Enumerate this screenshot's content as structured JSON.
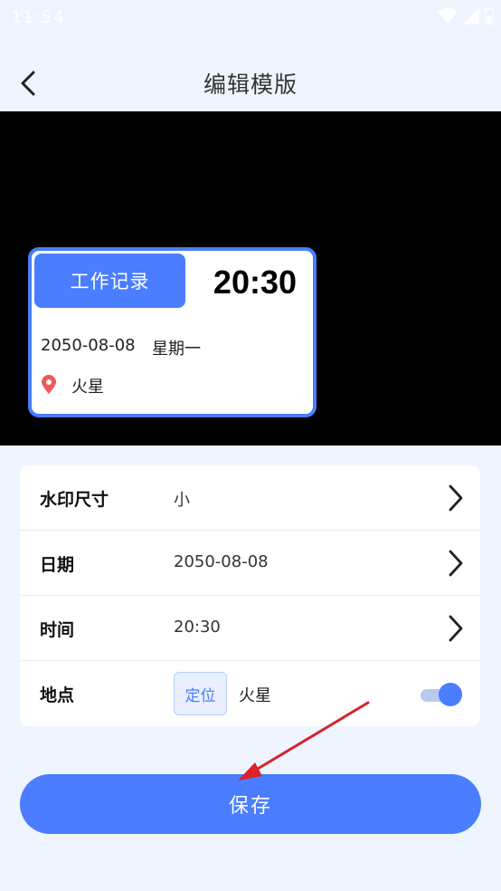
{
  "status_bar": {
    "time": "11:54",
    "icons": [
      "wifi-icon",
      "signal-icon",
      "battery-icon"
    ]
  },
  "header": {
    "title": "编辑模版",
    "back_icon": "chevron-left-icon"
  },
  "watermark": {
    "tag": "工作记录",
    "time": "20:30",
    "date": "2050-08-08",
    "weekday": "星期一",
    "location": "火星",
    "pin_icon": "location-pin-icon"
  },
  "settings": [
    {
      "label": "水印尺寸",
      "value": "小"
    },
    {
      "label": "日期",
      "value": "2050-08-08"
    },
    {
      "label": "时间",
      "value": "20:30"
    },
    {
      "label": "地点",
      "locate_button": "定位",
      "value": "火星",
      "toggle_on": true
    }
  ],
  "save_button": "保存",
  "colors": {
    "accent": "#4a7dff",
    "background": "#eff5fe",
    "preview_bg": "#000000",
    "annotation_arrow": "#d9222a",
    "pin": "#ee5a5a"
  }
}
